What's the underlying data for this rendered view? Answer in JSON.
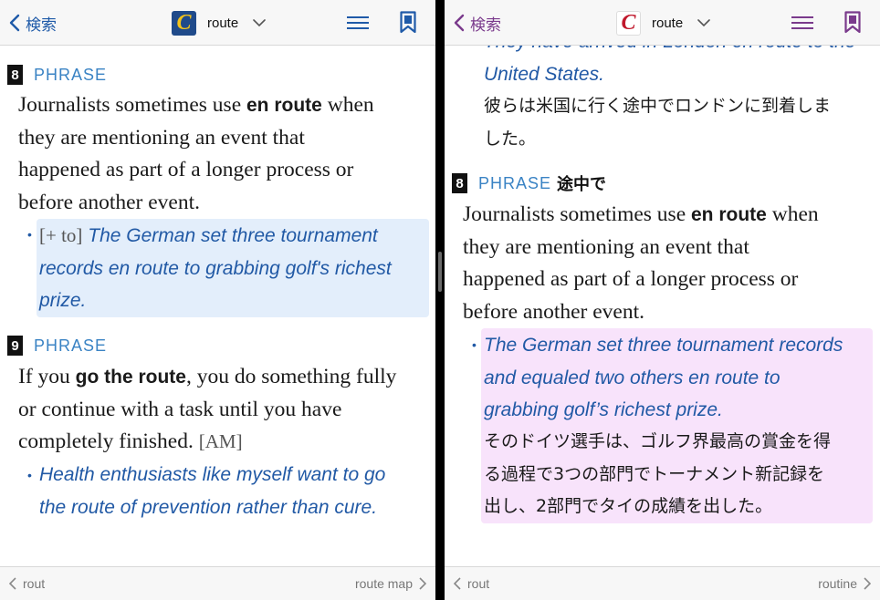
{
  "colors": {
    "accent_blue": "#1f5aa8",
    "accent_purple": "#7a3a8c",
    "phrase_blue": "#3a83c4",
    "example_blue": "#2159a5",
    "highlight_blue": "#e3eefb",
    "highlight_pink": "#f8e3fb"
  },
  "left": {
    "nav": {
      "back_label": "検索",
      "title": "route",
      "logo_letter": "C"
    },
    "sense8": {
      "number": "8",
      "label": "PHRASE",
      "def_lines": [
        "Journalists sometimes use ",
        "en route",
        " when",
        "they are mentioning an event that",
        "happened as part of a longer process or",
        "before another event."
      ],
      "example_grammar": "[+ to]",
      "example_lines": [
        "The German set three tournament",
        "records en route to grabbing golf's richest",
        "prize."
      ]
    },
    "sense9": {
      "number": "9",
      "label": "PHRASE",
      "def_lines": [
        "If you ",
        "go the route",
        ", you do something fully",
        "or continue with a task until you have",
        "completely finished. ",
        "[AM]"
      ],
      "example_lines": [
        "Health enthusiasts like myself want to go",
        "the route of prevention rather than cure."
      ]
    },
    "footer": {
      "prev": "rout",
      "next": "route map"
    }
  },
  "right": {
    "nav": {
      "back_label": "検索",
      "title": "route",
      "logo_letter": "C"
    },
    "prev_example": {
      "lines": [
        "They have arrived in London en route to the",
        "United States."
      ],
      "ja_lines": [
        "彼らは米国に行く途中でロンドンに到着しま",
        "した。"
      ]
    },
    "sense8": {
      "number": "8",
      "label": "PHRASE",
      "ja_label": "途中で",
      "def_lines": [
        "Journalists sometimes use ",
        "en route",
        " when",
        "they are mentioning an event that",
        "happened as part of a longer process or",
        "before another event."
      ],
      "example_lines": [
        "The German set three tournament records",
        "and equaled two others en route to",
        "grabbing golf’s richest prize."
      ],
      "ja_lines": [
        "そのドイツ選手は、ゴルフ界最高の賞金を得",
        "る過程で3つの部門でトーナメント新記録を",
        "出し、2部門でタイの成績を出した。"
      ]
    },
    "footer": {
      "prev": "rout",
      "next": "routine"
    }
  }
}
